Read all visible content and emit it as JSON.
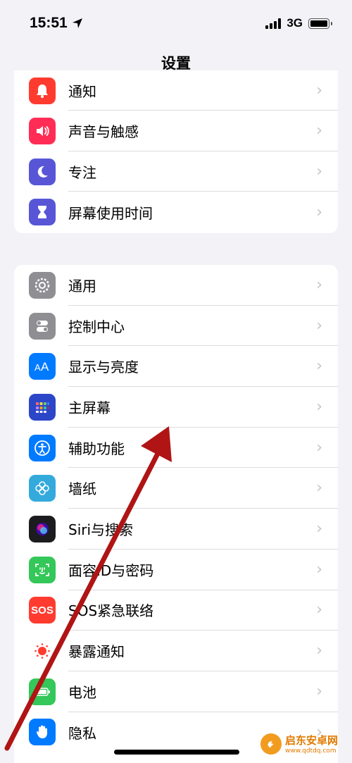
{
  "status": {
    "time": "15:51",
    "network": "3G"
  },
  "nav": {
    "title": "设置"
  },
  "groups": [
    {
      "items": [
        {
          "label": "通知",
          "icon": "bell-icon",
          "color": "#ff3b30"
        },
        {
          "label": "声音与触感",
          "icon": "speaker-icon",
          "color": "#ff2d55"
        },
        {
          "label": "专注",
          "icon": "moon-icon",
          "color": "#5856d6"
        },
        {
          "label": "屏幕使用时间",
          "icon": "hourglass-icon",
          "color": "#5856d6"
        }
      ]
    },
    {
      "items": [
        {
          "label": "通用",
          "icon": "gear-icon",
          "color": "#8e8e93"
        },
        {
          "label": "控制中心",
          "icon": "toggles-icon",
          "color": "#8e8e93"
        },
        {
          "label": "显示与亮度",
          "icon": "text-size-icon",
          "color": "#007aff"
        },
        {
          "label": "主屏幕",
          "icon": "app-grid-icon",
          "color": "#2c46c8"
        },
        {
          "label": "辅助功能",
          "icon": "accessibility-icon",
          "color": "#007aff"
        },
        {
          "label": "墙纸",
          "icon": "flower-icon",
          "color": "#34aadc"
        },
        {
          "label": "Siri与搜索",
          "icon": "siri-icon",
          "color": "#1c1c1e"
        },
        {
          "label": "面容ID与密码",
          "icon": "face-id-icon",
          "color": "#34c759"
        },
        {
          "label": "SOS紧急联络",
          "icon": "sos-icon",
          "color": "#ff3b30"
        },
        {
          "label": "暴露通知",
          "icon": "exposure-icon",
          "color": "#ffffff"
        },
        {
          "label": "电池",
          "icon": "battery-icon",
          "color": "#34c759"
        },
        {
          "label": "隐私",
          "icon": "hand-icon",
          "color": "#007aff"
        }
      ]
    }
  ],
  "sos_text": "SOS",
  "watermark": {
    "name": "启东安卓网",
    "url": "www.qdtdq.com"
  }
}
